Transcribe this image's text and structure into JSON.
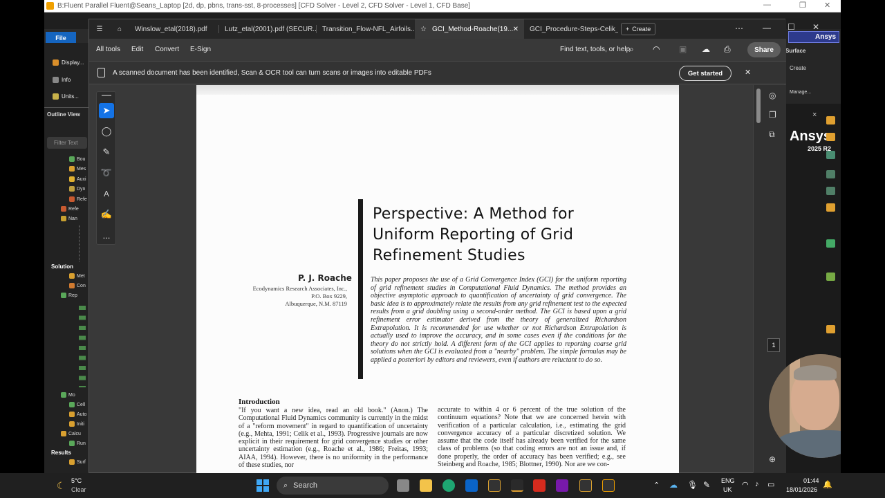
{
  "fluent": {
    "title": "B:Fluent Parallel Fluent@Seans_Laptop  [2d, dp, pbns, trans-sst, 8-processes] [CFD Solver - Level 2, CFD Solver - Level 1, CFD Base]",
    "file_tab": "File",
    "ribbon_items": [
      "Display...",
      "Info",
      "Units..."
    ],
    "outline_view": "Outline View",
    "filter_placeholder": "Filter Text",
    "tree": [
      "Bou",
      "Mes",
      "Auxi",
      "Dyn",
      "Refe",
      "Refe",
      "Nan",
      "Solution",
      "Met",
      "Con",
      "Rep",
      "Mo",
      "Cell",
      "Auto",
      "Initi",
      "Calcu",
      "Run",
      "Results",
      "Surf"
    ],
    "ansys_badge": "Ansys",
    "surface_label": "Surface",
    "create_label": "Create",
    "manage_label": "Manage...",
    "ansys_logo": "Ansys",
    "ansys_version": "2025 R2",
    "close_symbol": "×"
  },
  "acrobat": {
    "tabs": [
      {
        "label": "Winslow_etal(2018).pdf"
      },
      {
        "label": "Lutz_etal(2001).pdf (SECUR..."
      },
      {
        "label": "Transition_Flow-NFL_Airfoils..."
      },
      {
        "label": "GCI_Method-Roache(19..."
      },
      {
        "label": "GCI_Procedure-Steps-Celik_..."
      }
    ],
    "create_button": "Create",
    "menu": [
      "All tools",
      "Edit",
      "Convert",
      "E-Sign"
    ],
    "find_text": "Find text, tools, or help",
    "share": "Share",
    "scan_message": "A scanned document has been identified, Scan & OCR tool can turn scans or images into editable PDFs",
    "get_started": "Get started",
    "page_number": "1",
    "more_tools": "..."
  },
  "paper": {
    "title_lines": [
      "Perspective: A Method for",
      "Uniform Reporting of Grid",
      "Refinement Studies"
    ],
    "author": "P. J. Roache",
    "affiliation": [
      "Ecodynamics Research Associates, Inc.,",
      "P.O. Box 9229,",
      "Albuquerque, N.M. 87119"
    ],
    "abstract": "This paper proposes the use of a Grid Convergence Index (GCI) for the uniform reporting of grid refinement studies in Computational Fluid Dynamics. The method provides an objective asymptotic approach to quantification of uncertainty of grid convergence. The basic idea is to approximately relate the results from any grid refinement test to the expected results from a grid doubling using a second-order method. The GCI is based upon a grid refinement error estimator derived from the theory of generalized Richardson Extrapolation. It is recommended for use whether or not Richardson Extrapolation is actually used to improve the accuracy, and in some cases even if the conditions for the theory do not strictly hold. A different form of the GCI applies to reporting coarse grid solutions when the GCI is evaluated from a \"nearby\" problem. The simple formulas may be applied a posteriori by editors and reviewers, even if authors are reluctant to do so.",
    "intro_heading": "Introduction",
    "intro_col1": "\"If you want a new idea, read an old book.\" (Anon.) The Computational Fluid Dynamics community is currently in the midst of a \"reform movement\" in regard to quantification of uncertainty (e.g., Mehta, 1991; Celik et al., 1993). Progressive journals are now explicit in their requirement for grid convergence studies or other uncertainty estimation (e.g., Roache et al., 1986; Freitas, 1993; AIAA, 1994). However, there is no uniformity in the performance of these studies, nor",
    "intro_col2": "accurate to within 4 or 6 percent of the true solution of the continuum equations? Note that we are concerned herein with verification of a particular calculation, i.e., estimating the grid convergence accuracy of a particular discretized solution. We assume that the code itself has already been verified for the same class of problems (so that coding errors are not an issue and, if done properly, the order of accuracy has been verified; e.g., see Steinberg and Roache, 1985; Blottner, 1990). Nor are we con-"
  },
  "taskbar": {
    "weather_temp": "5°C",
    "weather_desc": "Clear",
    "search": "Search",
    "lang_line1": "ENG",
    "lang_line2": "UK",
    "time": "01:44",
    "date": "18/01/2026"
  },
  "colors": {
    "acrobat_red": "#d52b1e",
    "ansys_blue": "#2d3a8c",
    "fluent_orange": "#f0a000"
  }
}
